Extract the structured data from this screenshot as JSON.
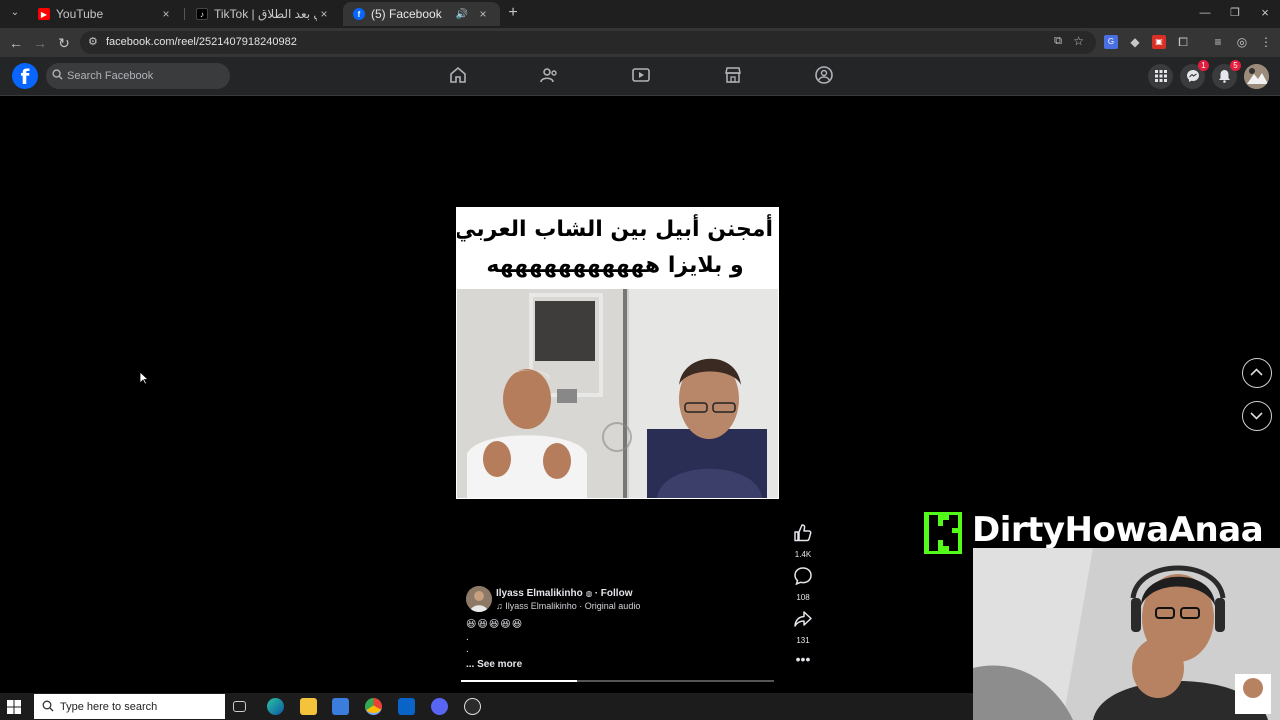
{
  "browser": {
    "tabs": [
      {
        "label": "YouTube",
        "icon": "youtube-icon",
        "color": "#ff0000",
        "active": false
      },
      {
        "label": "TikTok | تطورات حياتي بعد الطلاق",
        "icon": "tiktok-icon",
        "color": "#000000",
        "active": false
      },
      {
        "label": "(5) Facebook",
        "icon": "facebook-icon",
        "color": "#0866ff",
        "active": true
      }
    ],
    "new_tab": "+",
    "url": "facebook.com/reel/2521407918240982"
  },
  "facebook": {
    "logo": "f",
    "search_placeholder": "Search Facebook",
    "messenger_badge": "1",
    "notifications_badge": "5"
  },
  "reel": {
    "caption_line1": "أمجنن أبيل بين الشاب العربي",
    "caption_line2": "و بلايزا هههههههههههه",
    "likes": "1.4K",
    "comments": "108",
    "shares": "131",
    "author": "Ilyass Elmalikinho",
    "follow": "· Follow",
    "audio": "Ilyass Elmalikinho · Original audio",
    "emojis": "😆😆😆😆😆",
    "dot_line": ".",
    "see_more": "... See more",
    "progress_fraction": 0.37
  },
  "overlay": {
    "streamer_name": "DirtyHowaAnaa",
    "kick_letter": "K"
  },
  "taskbar": {
    "search_placeholder": "Type here to search"
  },
  "colors": {
    "fb_blue": "#0866ff",
    "kick_green": "#53fc18",
    "badge_red": "#e41e3f"
  }
}
